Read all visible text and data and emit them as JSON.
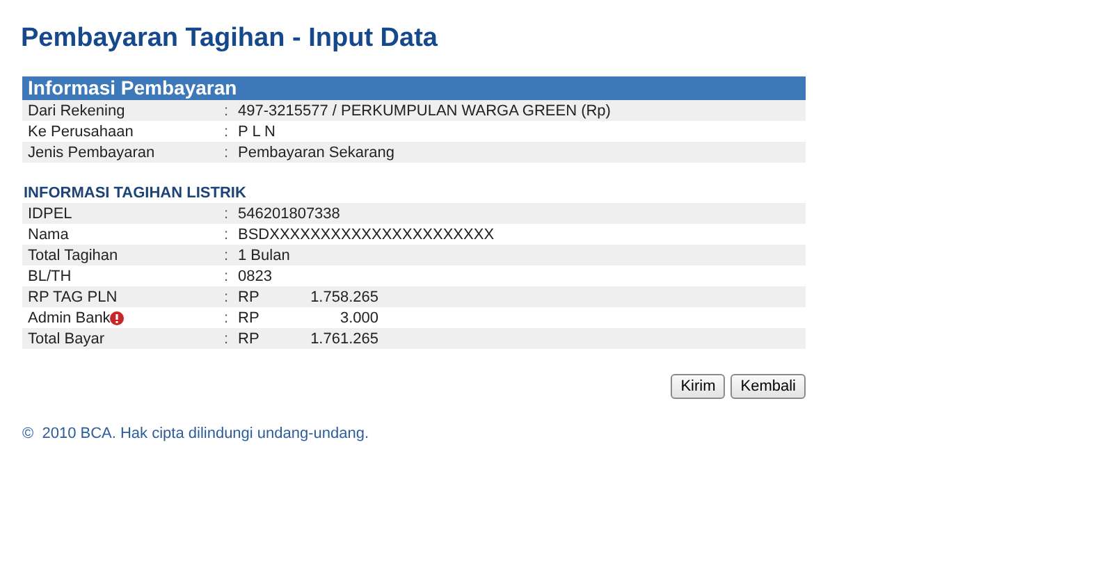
{
  "page_title": "Pembayaran Tagihan - Input Data",
  "payment_info": {
    "title": "Informasi Pembayaran",
    "rows": [
      {
        "label": "Dari Rekening",
        "separator": ":",
        "kind": "text",
        "value": "497-3215577 / PERKUMPULAN WARGA GREEN (Rp)"
      },
      {
        "label": "Ke Perusahaan",
        "separator": ":",
        "kind": "text",
        "value": "P L N"
      },
      {
        "label": "Jenis Pembayaran",
        "separator": ":",
        "kind": "text",
        "value": "Pembayaran Sekarang"
      }
    ]
  },
  "bill_info": {
    "title": "INFORMASI TAGIHAN LISTRIK",
    "rows": [
      {
        "label": "IDPEL",
        "separator": ":",
        "kind": "text",
        "value": "546201807338",
        "alert": false
      },
      {
        "label": "Nama",
        "separator": ":",
        "kind": "text",
        "value": "BSDXXXXXXXXXXXXXXXXXXXXXX",
        "alert": false
      },
      {
        "label": "Total Tagihan",
        "separator": ":",
        "kind": "text",
        "value": "1 Bulan",
        "alert": false
      },
      {
        "label": "BL/TH",
        "separator": ":",
        "kind": "text",
        "value": "0823",
        "alert": false
      },
      {
        "label": "RP TAG PLN",
        "separator": ":",
        "kind": "money",
        "currency": "RP",
        "value": "1.758.265",
        "alert": false
      },
      {
        "label": "Admin Bank",
        "separator": ":",
        "kind": "money",
        "currency": "RP",
        "value": "3.000",
        "alert": true
      },
      {
        "label": "Total Bayar",
        "separator": ":",
        "kind": "money",
        "currency": "RP",
        "value": "1.761.265",
        "alert": false
      }
    ]
  },
  "buttons": [
    "Kirim",
    "Kembali"
  ],
  "footer": "©  2010 BCA. Hak cipta dilindungi undang-undang."
}
